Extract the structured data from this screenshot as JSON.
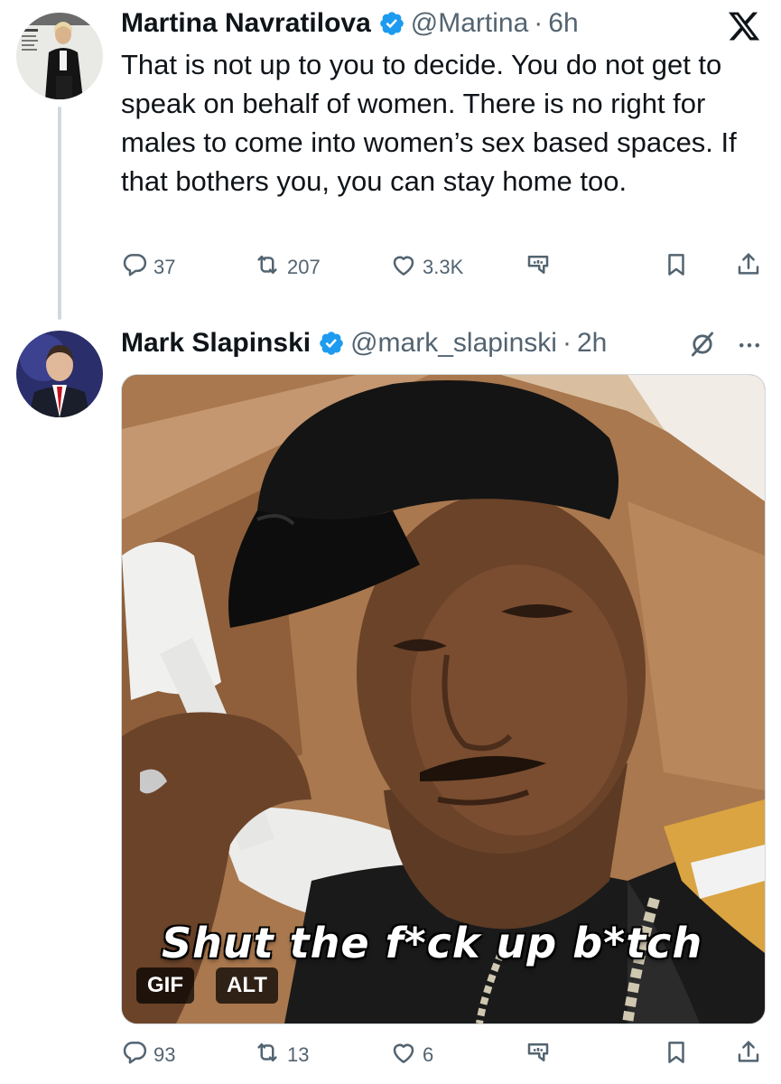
{
  "thread": {
    "parent": {
      "display_name": "Martina Navratilova",
      "handle": "@Martina",
      "separator": "·",
      "time": "6h",
      "text": "That is not up to you to decide. You do not get to speak on behalf of women. There is no right for males to come into women’s sex based spaces. If that bothers you, you can stay home too.",
      "verified": true,
      "stats": {
        "replies": "37",
        "retweets": "207",
        "likes": "3.3K"
      }
    },
    "reply": {
      "display_name": "Mark Slapinski",
      "handle": "@mark_slapinski",
      "separator": "·",
      "time": "2h",
      "verified": true,
      "media": {
        "caption": "Shut the f*ck up b*tch",
        "gif_badge": "GIF",
        "alt_badge": "ALT"
      },
      "stats": {
        "replies": "93",
        "retweets": "13",
        "likes": "6"
      }
    }
  },
  "icons": {
    "app_logo": "x-logo-icon",
    "verified": "verified-badge-icon",
    "reply": "reply-icon",
    "retweet": "retweet-icon",
    "like": "like-icon",
    "views": "views-icon",
    "bookmark": "bookmark-icon",
    "share": "share-icon",
    "grok": "grok-icon",
    "more": "more-icon"
  },
  "colors": {
    "verified_blue": "#1d9bf0",
    "secondary_text": "#536471",
    "primary_text": "#0f1419",
    "thread_line": "#cfd9de"
  }
}
